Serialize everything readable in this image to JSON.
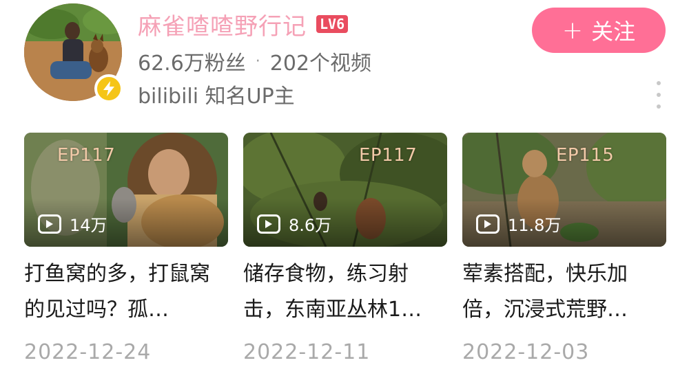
{
  "profile": {
    "name": "麻雀喳喳野行记",
    "level": "LV6",
    "fans": "62.6万粉丝",
    "separator": "·",
    "videos_count": "202个视频",
    "description": "bilibili 知名UP主",
    "follow_button": {
      "plus": "+",
      "label": "关注"
    },
    "avatar_icon": "avatar",
    "verify_icon": "lightning-bolt-icon",
    "more_icon": "vertical-ellipsis-icon"
  },
  "videos": [
    {
      "episode": "EP117",
      "plays": "14万",
      "title": "打鱼窝的多，打鼠窝的见过吗？孤…",
      "date": "2022-12-24"
    },
    {
      "episode": "EP117",
      "plays": "8.6万",
      "title": "储存食物，练习射击，东南亚丛林1…",
      "date": "2022-12-11"
    },
    {
      "episode": "EP115",
      "plays": "11.8万",
      "title": "荤素搭配，快乐加倍，沉浸式荒野…",
      "date": "2022-12-03"
    }
  ],
  "colors": {
    "brand_pink": "#ff6f96",
    "name_pink": "#f5a1b6",
    "level_red": "#e94c5f",
    "verify_yellow": "#f5c518",
    "secondary_text": "#6b6b6b",
    "date_text": "#a9a9a9"
  }
}
